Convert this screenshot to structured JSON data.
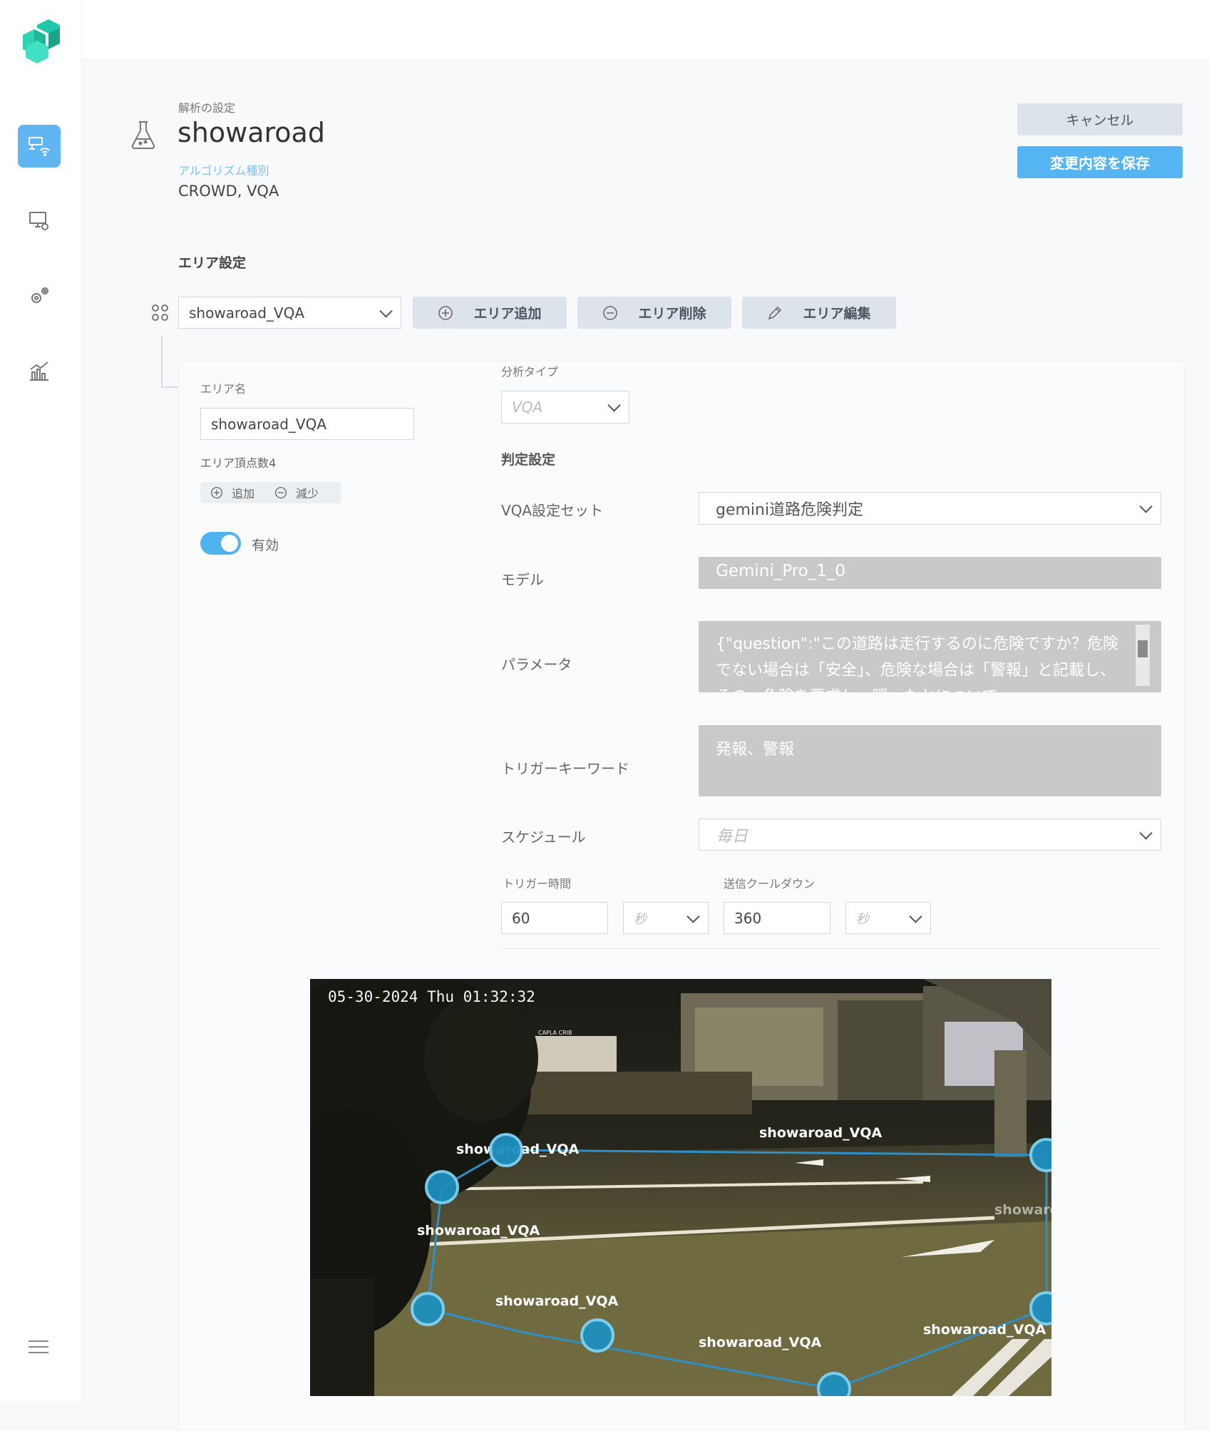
{
  "header": {
    "breadcrumb": "解析の設定",
    "title": "showaroad",
    "algorithm_label": "アルゴリズム種別",
    "algorithm_value": "CROWD, VQA",
    "cancel_label": "キャンセル",
    "save_label": "変更内容を保存"
  },
  "area": {
    "section_title": "エリア設定",
    "selected_area": "showaroad_VQA",
    "add_area_label": "エリア追加",
    "delete_area_label": "エリア削除",
    "edit_area_label": "エリア編集",
    "name_label": "エリア名",
    "name_value": "showaroad_VQA",
    "vertex_count_label": "エリア頂点数4",
    "vertex_add_label": "追加",
    "vertex_remove_label": "減少",
    "enabled_label": "有効",
    "enabled": true
  },
  "analysis": {
    "type_label": "分析タイプ",
    "type_placeholder": "VQA",
    "judgement_title": "判定設定",
    "vqa_set_label": "VQA設定セット",
    "vqa_set_value": "gemini道路危険判定",
    "model_label": "モデル",
    "model_value": "Gemini_Pro_1_0",
    "params_label": "パラメータ",
    "params_value": "{\"question\":\"この道路は走行するのに危険ですか？危険でない場合は「安全」、危険な場合は「警報」と記載し、その…危険を要求し、瞬ったかについて",
    "trigger_keyword_label": "トリガーキーワード",
    "trigger_keyword_value": "発報、警報",
    "schedule_label": "スケジュール",
    "schedule_placeholder": "毎日",
    "trigger_time_label": "トリガー時間",
    "trigger_time_value": "60",
    "trigger_time_unit": "秒",
    "cooldown_label": "送信クールダウン",
    "cooldown_value": "360",
    "cooldown_unit": "秒"
  },
  "camera": {
    "timestamp": "05-30-2024 Thu 01:32:32",
    "store_sign": "CAPLA CRIB",
    "polygon_label": "showaroad_VQA"
  },
  "colors": {
    "accent": "#55b5f2",
    "toggle": "#4fb3ef",
    "polygon": "#2e8fc7"
  }
}
